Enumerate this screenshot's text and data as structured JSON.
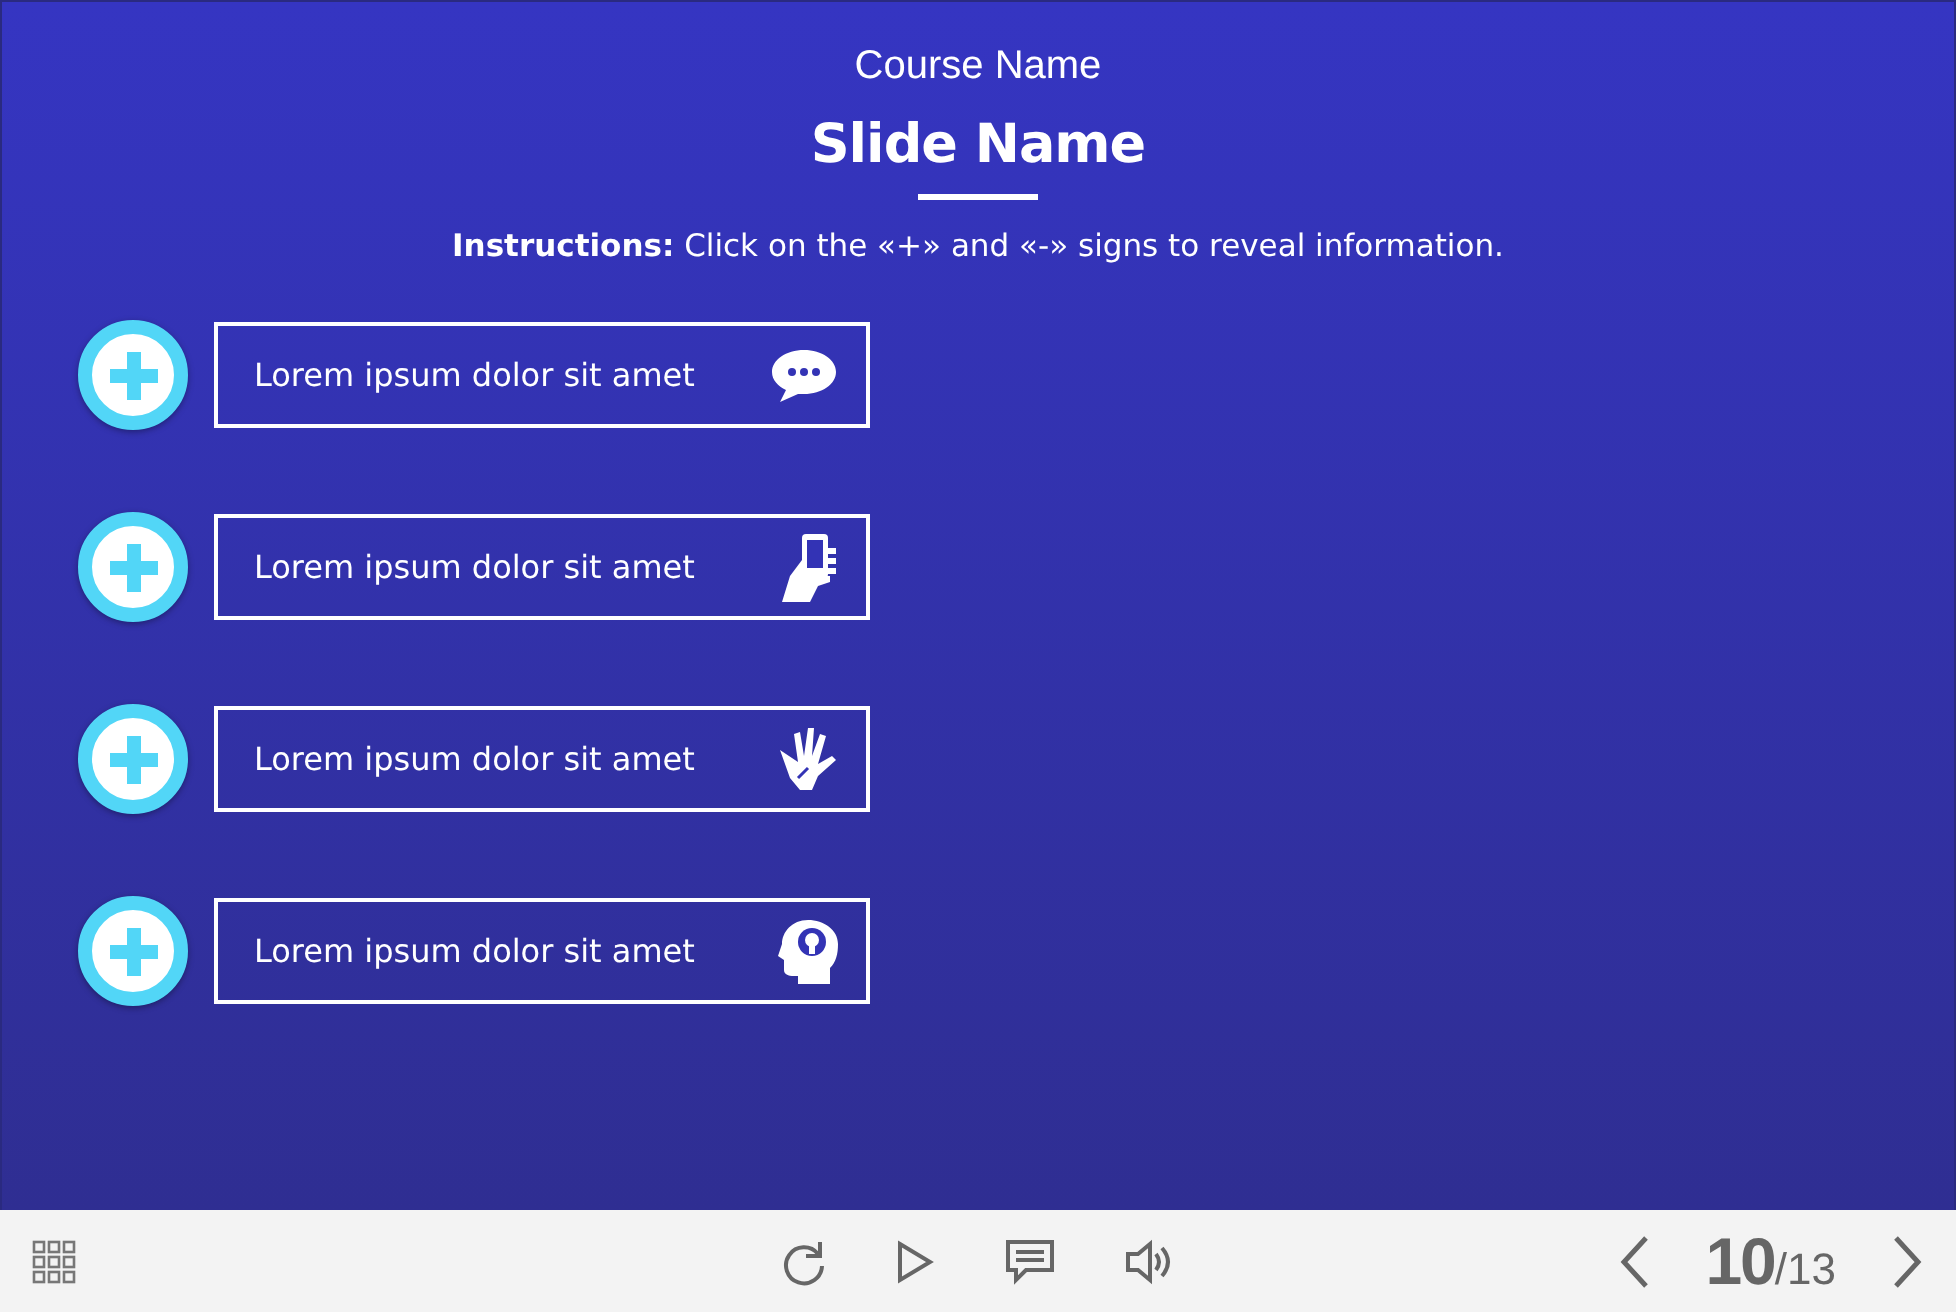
{
  "header": {
    "course_name": "Course Name",
    "slide_name": "Slide Name",
    "instructions": "**Instructions:** Click on the «+» and «-» signs to reveal information."
  },
  "items": [
    {
      "label": "Lorem ipsum dolor sit amet",
      "expanded": false
    },
    {
      "label": "Lorem ipsum dolor sit amet",
      "expanded": false
    },
    {
      "label": "Lorem ipsum dolor sit amet",
      "expanded": false
    },
    {
      "label": "Lorem ipsum dolor sit amet",
      "expanded": false
    }
  ],
  "player_bar": {
    "current_slide": "10",
    "total_slides": "/13"
  }
}
